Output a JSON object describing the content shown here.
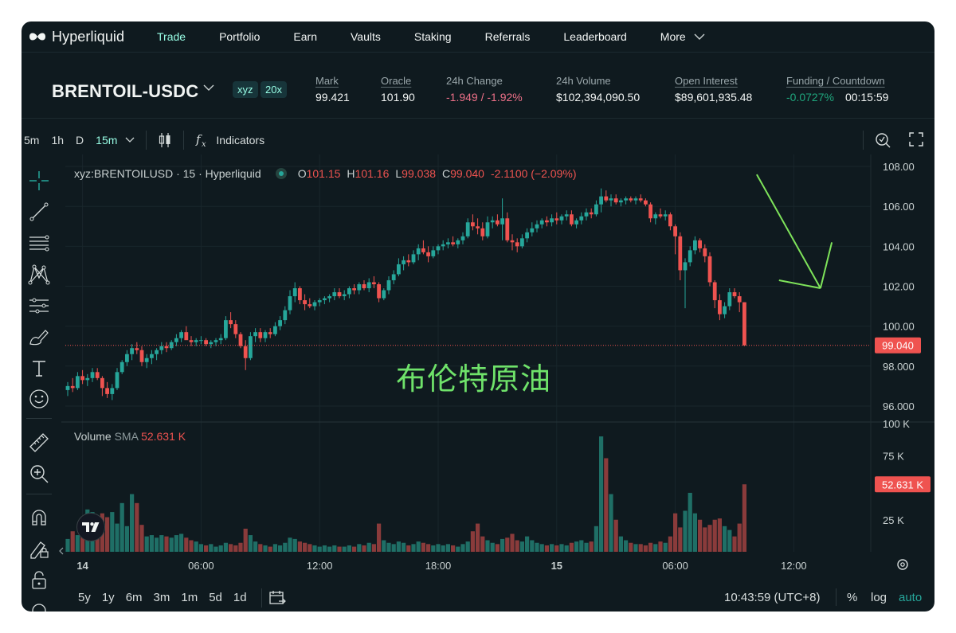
{
  "nav": {
    "logo_text": "Hyperliquid",
    "items": [
      "Trade",
      "Portfolio",
      "Earn",
      "Vaults",
      "Staking",
      "Referrals",
      "Leaderboard"
    ],
    "active": "Trade",
    "more_label": "More"
  },
  "market": {
    "pair": "BRENTOIL-USDC",
    "badges": [
      "xyz",
      "20x"
    ],
    "stats": {
      "mark": {
        "label": "Mark",
        "value": "99.421"
      },
      "oracle": {
        "label": "Oracle",
        "value": "101.90"
      },
      "change": {
        "label": "24h Change",
        "value": "-1.949 / -1.92%"
      },
      "volume": {
        "label": "24h Volume",
        "value": "$102,394,090.50"
      },
      "open_interest": {
        "label": "Open Interest",
        "value": "$89,601,935.48"
      },
      "funding": {
        "label": "Funding / Countdown",
        "rate": "-0.0727%",
        "countdown": "00:15:59"
      }
    }
  },
  "toolbar": {
    "timeframes": [
      "5m",
      "1h",
      "D",
      "15m"
    ],
    "selected_timeframe": "15m",
    "indicators_label": "Indicators"
  },
  "legend": {
    "symbol": "xyz:BRENTOILUSD · 15 · Hyperliquid",
    "o_label": "O",
    "o": "101.15",
    "h_label": "H",
    "h": "101.16",
    "l_label": "L",
    "l": "99.038",
    "c_label": "C",
    "c": "99.040",
    "change": "-2.1100 (−2.09%)"
  },
  "volume_legend": {
    "label": "Volume",
    "sma_label": "SMA",
    "value": "52.631 K"
  },
  "annotation_text": "布伦特原油",
  "bottom": {
    "ranges": [
      "5y",
      "1y",
      "6m",
      "3m",
      "1m",
      "5d",
      "1d"
    ],
    "timezone": "10:43:59 (UTC+8)",
    "percent_label": "%",
    "log_label": "log",
    "auto_label": "auto"
  },
  "colors": {
    "up": "#26a69a",
    "down": "#ef5350",
    "accent": "#97fce4",
    "drawing": "#7ee35a"
  },
  "icons": [
    "crosshair-icon",
    "trend-line-icon",
    "fib-lines-icon",
    "pattern-icon",
    "forecast-icon",
    "brush-icon",
    "text-icon",
    "emoji-icon",
    "ruler-icon",
    "zoom-in-icon",
    "magnet-icon",
    "lock-drawings-icon",
    "lock-icon",
    "settings-icon",
    "calendar-icon",
    "screenshot-icon",
    "fullscreen-icon",
    "candles-icon",
    "fx-icon"
  ],
  "chart_data": {
    "type": "candlestick",
    "price_ticks": [
      "108.00",
      "106.00",
      "104.00",
      "102.00",
      "100.00",
      "98.000",
      "96.000"
    ],
    "ylim": [
      95.2,
      108.6
    ],
    "last_price_label": "99.040",
    "last_price": 99.04,
    "volume_ticks": [
      "100 K",
      "75 K",
      "25 K"
    ],
    "volume_last_label": "52.631 K",
    "volume_last": 52.631,
    "volume_ylim": [
      0,
      100
    ],
    "x_ticks": [
      "14",
      "06:00",
      "12:00",
      "18:00",
      "15",
      "06:00",
      "12:00"
    ],
    "x_tick_bold": [
      true,
      false,
      false,
      false,
      true,
      false,
      false
    ],
    "x_tick_index": [
      3,
      27,
      51,
      75,
      99,
      123,
      147
    ],
    "candles": [
      [
        96.8,
        97.2,
        96.5,
        97.0,
        10
      ],
      [
        97.0,
        97.4,
        96.7,
        96.9,
        16
      ],
      [
        96.9,
        97.7,
        96.8,
        97.5,
        13
      ],
      [
        97.5,
        97.8,
        97.1,
        97.3,
        14
      ],
      [
        97.3,
        97.6,
        97.0,
        97.4,
        33
      ],
      [
        97.4,
        97.9,
        97.2,
        97.7,
        31
      ],
      [
        97.7,
        97.9,
        97.3,
        97.4,
        28
      ],
      [
        97.4,
        97.5,
        96.5,
        96.9,
        30
      ],
      [
        96.9,
        97.2,
        96.4,
        96.6,
        27
      ],
      [
        96.6,
        97.1,
        96.3,
        96.9,
        31
      ],
      [
        96.9,
        97.9,
        96.8,
        97.7,
        22
      ],
      [
        97.7,
        98.3,
        97.6,
        98.2,
        38
      ],
      [
        98.2,
        98.8,
        98.0,
        98.6,
        20
      ],
      [
        98.6,
        99.1,
        98.3,
        98.9,
        45
      ],
      [
        98.9,
        99.2,
        98.6,
        98.8,
        38
      ],
      [
        98.8,
        99.0,
        98.0,
        98.2,
        21
      ],
      [
        98.2,
        98.6,
        97.9,
        98.4,
        12
      ],
      [
        98.4,
        98.8,
        98.1,
        98.6,
        13
      ],
      [
        98.6,
        98.9,
        98.3,
        98.8,
        11
      ],
      [
        98.8,
        99.2,
        98.6,
        99.0,
        13
      ],
      [
        99.0,
        99.2,
        98.7,
        98.9,
        12
      ],
      [
        98.9,
        99.3,
        98.8,
        99.2,
        11
      ],
      [
        99.2,
        99.6,
        99.0,
        99.4,
        13
      ],
      [
        99.4,
        99.8,
        99.2,
        99.7,
        14
      ],
      [
        99.7,
        100.0,
        99.5,
        99.3,
        11
      ],
      [
        99.3,
        99.5,
        99.0,
        99.2,
        9
      ],
      [
        99.2,
        99.4,
        99.0,
        99.3,
        8
      ],
      [
        99.3,
        99.5,
        99.1,
        99.3,
        6
      ],
      [
        99.3,
        99.4,
        99.0,
        99.1,
        5
      ],
      [
        99.1,
        99.3,
        98.9,
        99.2,
        6
      ],
      [
        99.2,
        99.4,
        99.0,
        99.3,
        4
      ],
      [
        99.3,
        99.6,
        99.1,
        99.4,
        5
      ],
      [
        99.4,
        100.5,
        99.3,
        100.3,
        7
      ],
      [
        100.3,
        100.7,
        99.9,
        100.1,
        6
      ],
      [
        100.1,
        100.3,
        99.4,
        99.6,
        5
      ],
      [
        99.6,
        99.7,
        98.9,
        99.0,
        7
      ],
      [
        99.0,
        99.3,
        97.8,
        98.4,
        18
      ],
      [
        98.4,
        99.7,
        98.3,
        99.5,
        13
      ],
      [
        99.5,
        99.9,
        99.2,
        99.7,
        8
      ],
      [
        99.7,
        99.9,
        99.2,
        99.4,
        6
      ],
      [
        99.4,
        99.8,
        99.2,
        99.7,
        5
      ],
      [
        99.7,
        99.9,
        99.4,
        99.6,
        4
      ],
      [
        99.6,
        100.2,
        99.5,
        100.0,
        6
      ],
      [
        100.0,
        100.5,
        99.8,
        100.3,
        5
      ],
      [
        100.3,
        101.0,
        100.1,
        100.8,
        7
      ],
      [
        100.8,
        101.8,
        100.6,
        101.5,
        11
      ],
      [
        101.5,
        102.2,
        101.2,
        101.9,
        10
      ],
      [
        101.9,
        102.0,
        101.1,
        101.3,
        8
      ],
      [
        101.3,
        101.6,
        100.8,
        101.1,
        7
      ],
      [
        101.1,
        101.4,
        100.9,
        101.0,
        6
      ],
      [
        101.0,
        101.3,
        100.8,
        101.2,
        5
      ],
      [
        101.2,
        101.4,
        101.0,
        101.3,
        4
      ],
      [
        101.3,
        101.5,
        101.1,
        101.4,
        5
      ],
      [
        101.4,
        101.6,
        101.2,
        101.5,
        4
      ],
      [
        101.5,
        101.9,
        101.3,
        101.7,
        5
      ],
      [
        101.7,
        101.9,
        101.4,
        101.5,
        4
      ],
      [
        101.5,
        101.8,
        101.3,
        101.6,
        4
      ],
      [
        101.6,
        102.0,
        101.4,
        101.9,
        5
      ],
      [
        101.9,
        102.1,
        101.6,
        101.8,
        4
      ],
      [
        101.8,
        102.2,
        101.6,
        102.1,
        6
      ],
      [
        102.1,
        102.3,
        101.8,
        101.9,
        5
      ],
      [
        101.9,
        102.4,
        101.7,
        102.2,
        7
      ],
      [
        102.2,
        102.5,
        101.9,
        102.1,
        6
      ],
      [
        102.1,
        102.2,
        101.2,
        101.4,
        22
      ],
      [
        101.4,
        101.9,
        101.3,
        101.8,
        9
      ],
      [
        101.8,
        102.5,
        101.6,
        102.3,
        7
      ],
      [
        102.3,
        102.8,
        102.1,
        102.6,
        6
      ],
      [
        102.6,
        103.4,
        102.5,
        103.1,
        8
      ],
      [
        103.1,
        103.5,
        102.8,
        103.3,
        7
      ],
      [
        103.3,
        103.6,
        103.0,
        103.2,
        5
      ],
      [
        103.2,
        103.8,
        103.1,
        103.6,
        6
      ],
      [
        103.6,
        104.1,
        103.3,
        103.9,
        8
      ],
      [
        103.9,
        104.3,
        103.6,
        103.7,
        7
      ],
      [
        103.7,
        104.0,
        103.2,
        103.5,
        6
      ],
      [
        103.5,
        104.0,
        103.4,
        103.8,
        5
      ],
      [
        103.8,
        104.1,
        103.6,
        104.0,
        6
      ],
      [
        104.0,
        104.3,
        103.8,
        104.1,
        5
      ],
      [
        104.1,
        104.4,
        103.9,
        104.2,
        6
      ],
      [
        104.2,
        104.5,
        104.0,
        104.1,
        5
      ],
      [
        104.1,
        104.4,
        103.9,
        104.3,
        4
      ],
      [
        104.3,
        104.7,
        104.1,
        104.5,
        6
      ],
      [
        104.5,
        105.4,
        104.4,
        105.2,
        8
      ],
      [
        105.2,
        105.6,
        104.8,
        105.0,
        16
      ],
      [
        105.0,
        105.4,
        104.6,
        104.9,
        22
      ],
      [
        104.9,
        105.2,
        104.3,
        104.5,
        12
      ],
      [
        104.5,
        105.5,
        104.4,
        105.2,
        9
      ],
      [
        105.2,
        105.5,
        104.9,
        105.3,
        7
      ],
      [
        105.3,
        105.6,
        105.0,
        105.1,
        6
      ],
      [
        105.1,
        106.4,
        104.3,
        105.4,
        10
      ],
      [
        105.4,
        105.7,
        104.2,
        104.3,
        11
      ],
      [
        104.3,
        104.6,
        103.8,
        104.2,
        14
      ],
      [
        104.2,
        104.4,
        103.7,
        104.0,
        9
      ],
      [
        104.0,
        104.6,
        103.9,
        104.4,
        8
      ],
      [
        104.4,
        104.9,
        104.2,
        104.7,
        12
      ],
      [
        104.7,
        105.2,
        104.5,
        104.9,
        9
      ],
      [
        104.9,
        105.3,
        104.7,
        105.1,
        7
      ],
      [
        105.1,
        105.4,
        104.9,
        105.3,
        6
      ],
      [
        105.3,
        105.5,
        105.0,
        105.2,
        5
      ],
      [
        105.2,
        105.6,
        105.0,
        105.4,
        6
      ],
      [
        105.4,
        105.7,
        105.1,
        105.3,
        5
      ],
      [
        105.3,
        105.6,
        105.1,
        105.5,
        6
      ],
      [
        105.5,
        105.8,
        105.3,
        105.6,
        5
      ],
      [
        105.6,
        105.8,
        105.0,
        105.1,
        7
      ],
      [
        105.1,
        105.4,
        104.9,
        105.3,
        8
      ],
      [
        105.3,
        105.7,
        105.1,
        105.5,
        9
      ],
      [
        105.5,
        105.9,
        105.3,
        105.7,
        7
      ],
      [
        105.7,
        105.9,
        105.4,
        105.6,
        8
      ],
      [
        105.6,
        106.3,
        105.5,
        106.1,
        20
      ],
      [
        106.1,
        106.9,
        105.7,
        106.5,
        90
      ],
      [
        106.5,
        106.8,
        106.2,
        106.3,
        73
      ],
      [
        106.3,
        106.6,
        106.0,
        106.4,
        45
      ],
      [
        106.4,
        106.6,
        106.1,
        106.2,
        25
      ],
      [
        106.2,
        106.4,
        106.0,
        106.3,
        12
      ],
      [
        106.3,
        106.5,
        106.1,
        106.4,
        9
      ],
      [
        106.4,
        106.5,
        106.2,
        106.3,
        7
      ],
      [
        106.3,
        106.5,
        106.1,
        106.4,
        6
      ],
      [
        106.4,
        106.6,
        106.2,
        106.3,
        6
      ],
      [
        106.3,
        106.4,
        106.0,
        106.1,
        5
      ],
      [
        106.1,
        106.2,
        105.2,
        105.4,
        7
      ],
      [
        105.4,
        105.7,
        105.1,
        105.6,
        6
      ],
      [
        105.6,
        105.9,
        105.4,
        105.5,
        8
      ],
      [
        105.5,
        105.8,
        105.3,
        105.6,
        7
      ],
      [
        105.6,
        105.7,
        104.8,
        105.0,
        12
      ],
      [
        105.0,
        105.1,
        103.6,
        104.5,
        30
      ],
      [
        104.5,
        104.7,
        102.3,
        102.8,
        19
      ],
      [
        102.8,
        103.4,
        100.9,
        103.2,
        32
      ],
      [
        103.2,
        104.0,
        103.0,
        103.8,
        46
      ],
      [
        103.8,
        104.5,
        103.6,
        104.3,
        30
      ],
      [
        104.3,
        104.4,
        103.7,
        103.9,
        25
      ],
      [
        103.9,
        104.1,
        103.2,
        103.5,
        19
      ],
      [
        103.5,
        103.7,
        102.0,
        102.2,
        21
      ],
      [
        102.2,
        102.3,
        100.9,
        101.3,
        25
      ],
      [
        101.3,
        101.6,
        100.3,
        100.6,
        26
      ],
      [
        100.6,
        101.2,
        100.4,
        101.0,
        20
      ],
      [
        101.0,
        101.9,
        100.8,
        101.7,
        17
      ],
      [
        101.7,
        101.9,
        101.4,
        101.5,
        12
      ],
      [
        101.5,
        101.7,
        100.7,
        101.2,
        22
      ],
      [
        101.2,
        101.2,
        99.0,
        99.04,
        52.631
      ]
    ],
    "drawings": [
      {
        "type": "trendline",
        "points": [
          [
            139.5,
            107.6
          ],
          [
            152.4,
            101.9
          ]
        ]
      },
      {
        "type": "trendline",
        "points": [
          [
            152.4,
            101.9
          ],
          [
            154.7,
            104.2
          ]
        ]
      },
      {
        "type": "trendline",
        "points": [
          [
            144.0,
            102.3
          ],
          [
            152.4,
            101.9
          ]
        ]
      }
    ]
  }
}
